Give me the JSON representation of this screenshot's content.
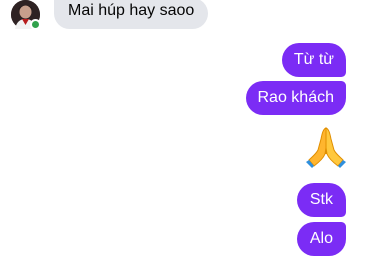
{
  "conversation": {
    "incoming": [
      {
        "text": "Mai húp hay saoo"
      }
    ],
    "outgoing": [
      {
        "text": "Từ từ"
      },
      {
        "text": "Rao khách"
      },
      {
        "emoji": "folded-hands-emoji"
      },
      {
        "text": "Stk"
      },
      {
        "text": "Alo"
      }
    ],
    "sender_status": "online",
    "colors": {
      "outgoing_bubble": "#7b2cf5",
      "incoming_bubble": "#e4e6eb",
      "online_dot": "#31a24c"
    }
  }
}
